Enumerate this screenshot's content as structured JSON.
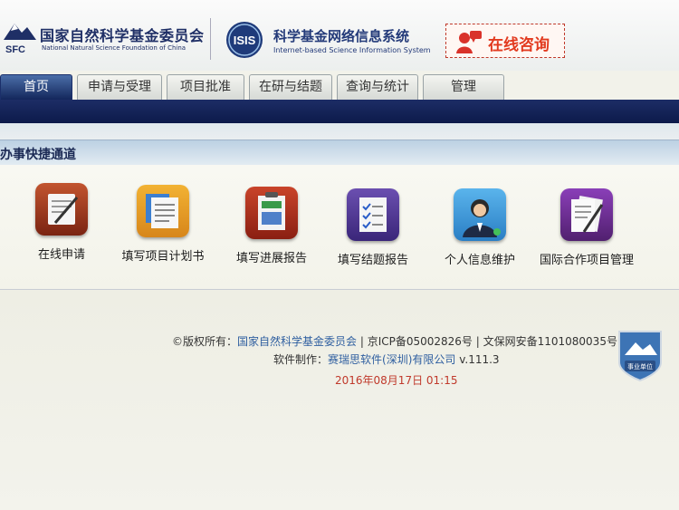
{
  "header": {
    "nsfc_logo_text": "SFC",
    "nsfc_title": "国家自然科学基金委员会",
    "nsfc_subtitle": "National Natural Science Foundation of China",
    "isis_logo_text": "ISIS",
    "isis_title": "科学基金网络信息系统",
    "isis_subtitle": "Internet-based Science Information System",
    "consult_label": "在线咨询"
  },
  "tabs": [
    {
      "label": "首页",
      "active": true
    },
    {
      "label": "申请与受理",
      "active": false
    },
    {
      "label": "项目批准",
      "active": false
    },
    {
      "label": "在研与结题",
      "active": false
    },
    {
      "label": "查询与统计",
      "active": false
    },
    {
      "label": "管理",
      "active": false
    }
  ],
  "quick": {
    "title": "办事快捷通道",
    "items": [
      {
        "label": "在线申请",
        "icon": "online-application-icon"
      },
      {
        "label": "填写项目计划书",
        "icon": "project-plan-icon"
      },
      {
        "label": "填写进展报告",
        "icon": "progress-report-icon"
      },
      {
        "label": "填写结题报告",
        "icon": "final-report-icon"
      },
      {
        "label": "个人信息维护",
        "icon": "personal-info-icon"
      },
      {
        "label": "国际合作项目管理",
        "icon": "international-project-icon"
      }
    ]
  },
  "footer": {
    "copyright_prefix": "©版权所有：",
    "org_link": "国家自然科学基金委员会",
    "icp": " | 京ICP备05002826号 | 文保网安备1101080035号",
    "software_prefix": "软件制作：",
    "software_link": "赛瑞思软件(深圳)有限公司",
    "version": " v.111.3",
    "timestamp": "2016年08月17日 01:15",
    "badge_text": "事业单位"
  },
  "colors": {
    "navy": "#13265b",
    "accent_red": "#e23a1f",
    "link_blue": "#2f5fa0"
  }
}
